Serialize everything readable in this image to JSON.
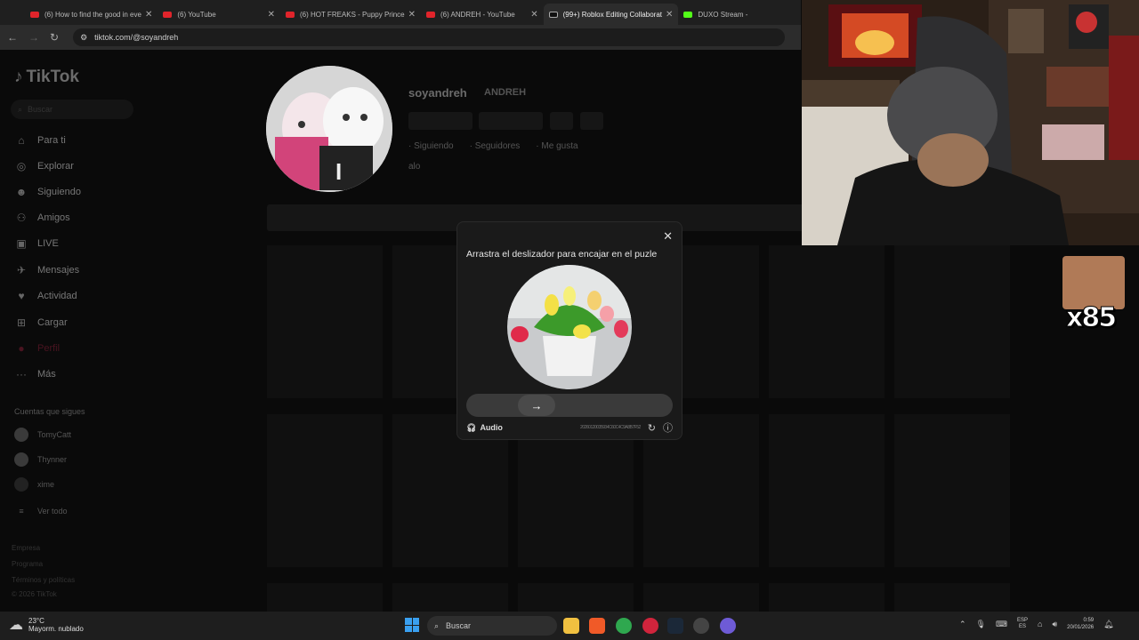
{
  "tabs": [
    {
      "label": "(6) How to find the good in eve",
      "icon": "youtube-icon"
    },
    {
      "label": "(6) YouTube",
      "icon": "youtube-icon"
    },
    {
      "label": "(6) HOT FREAKS - Puppy Prince",
      "icon": "youtube-icon"
    },
    {
      "label": "(6) ANDREH - YouTube",
      "icon": "youtube-icon"
    },
    {
      "label": "(99+) Roblox Editing Collaborat",
      "icon": "tiktok-icon",
      "active": true
    },
    {
      "label": "DUXO Stream - ",
      "icon": "kick-icon"
    }
  ],
  "address": {
    "url": "tiktok.com/@soyandreh"
  },
  "tiktok": {
    "logo": "TikTok",
    "search_placeholder": "Buscar",
    "nav": [
      {
        "label": "Para ti",
        "icon": "home-icon"
      },
      {
        "label": "Explorar",
        "icon": "compass-icon"
      },
      {
        "label": "Siguiendo",
        "icon": "following-icon"
      },
      {
        "label": "Amigos",
        "icon": "friends-icon"
      },
      {
        "label": "LIVE",
        "icon": "live-icon"
      },
      {
        "label": "Mensajes",
        "icon": "messages-icon"
      },
      {
        "label": "Actividad",
        "icon": "activity-icon"
      },
      {
        "label": "Cargar",
        "icon": "upload-icon"
      },
      {
        "label": "Perfil",
        "icon": "profile-icon"
      },
      {
        "label": "Más",
        "icon": "more-icon"
      }
    ],
    "following_heading": "Cuentas que sigues",
    "following": [
      "TomyCatt",
      "Thynner",
      "xime"
    ],
    "see_all": "Ver todo",
    "footer": [
      "Empresa",
      "Programa",
      "Términos y políticas",
      "© 2026 TikTok"
    ],
    "profile": {
      "username": "soyandreh",
      "nickname": "ANDREH",
      "stats": [
        "Siguiendo",
        "Seguidores",
        "Me gusta"
      ],
      "bio": "alo"
    }
  },
  "captcha": {
    "title": "Arrastra el deslizador para encajar en el puzle",
    "audio_label": "Audio",
    "code": "20260120035934C60C4C9A8B7F52"
  },
  "overlay": {
    "multiplier": "x85"
  },
  "taskbar": {
    "temperature": "23°C",
    "weather": "Mayorm. nublado",
    "search_label": "Buscar",
    "lang_top": "ESP",
    "lang_bottom": "ES",
    "time": "0:59",
    "date": "20/01/2026"
  }
}
